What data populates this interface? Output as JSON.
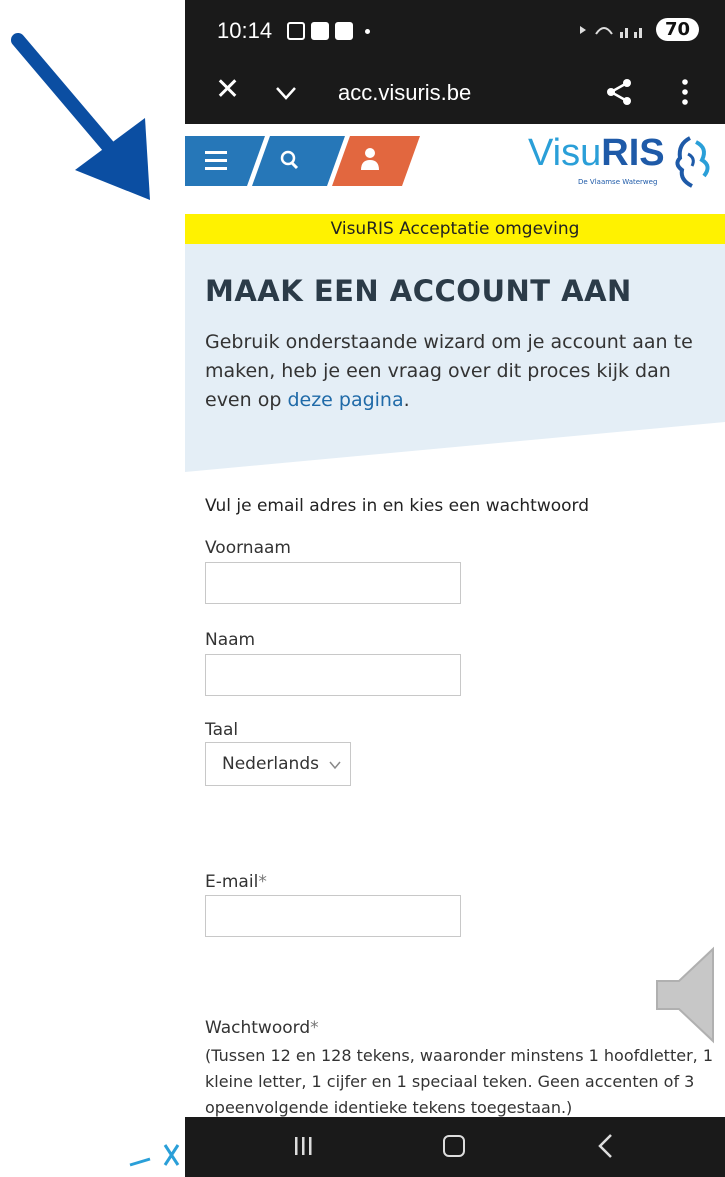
{
  "status_bar": {
    "time": "10:14",
    "battery": "70"
  },
  "browser": {
    "url": "acc.visuris.be"
  },
  "header": {
    "logo_main": "Visu",
    "logo_bold": "RIS",
    "logo_sub": "De Vlaamse Waterweg"
  },
  "banner": {
    "text": "VisuRIS Acceptatie omgeving"
  },
  "hero": {
    "title": "MAAK EEN ACCOUNT AAN",
    "text_before_link": "Gebruik onderstaande wizard  om je account aan te maken, heb je een vraag over dit proces kijk dan even op ",
    "link": "deze pagina",
    "text_after_link": "."
  },
  "form": {
    "intro": "Vul je email adres in en kies een wachtwoord",
    "firstname_label": "Voornaam",
    "firstname_value": "",
    "lastname_label": "Naam",
    "lastname_value": "",
    "language_label": "Taal",
    "language_value": "Nederlands",
    "email_label": "E-mail",
    "email_value": "",
    "password_label": "Wachtwoord",
    "required_marker": "*",
    "password_hint": "(Tussen 12 en 128 tekens, waaronder minstens 1 hoofdletter, 1 kleine letter, 1 cijfer en 1 speciaal teken. Geen accenten of 3 opeenvolgende identieke tekens toegestaan.)"
  },
  "colors": {
    "arrow": "#0b4ea2",
    "nav_blue": "#2677b8",
    "nav_orange": "#e2673f",
    "banner": "#fff200",
    "hero_bg": "#e4eef6",
    "link": "#1f6aa8"
  },
  "icons": [
    "menu-icon",
    "search-icon",
    "user-icon",
    "close-icon",
    "chevron-down-icon",
    "share-icon",
    "more-icon",
    "speaker-icon",
    "lion-logo-icon"
  ]
}
